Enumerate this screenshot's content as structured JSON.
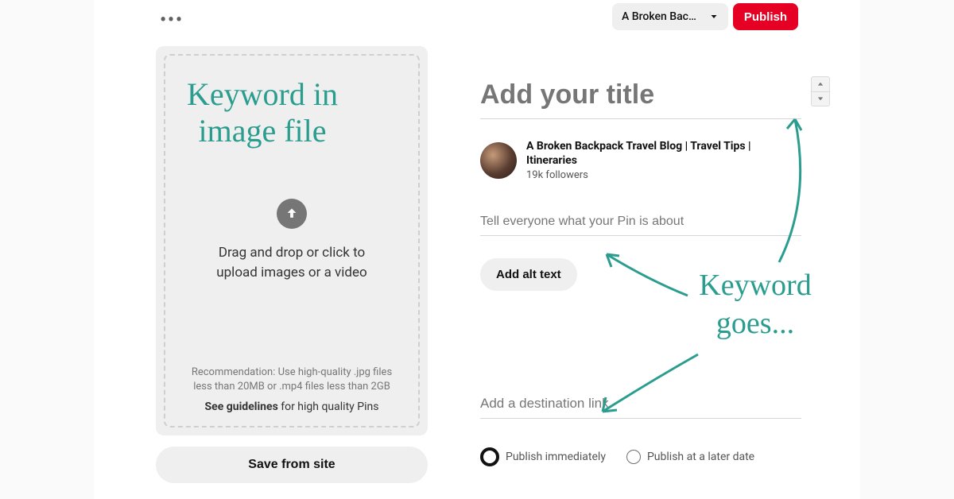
{
  "header": {
    "board_selected_label": "A Broken Bac…",
    "publish_label": "Publish"
  },
  "upload": {
    "instruction": "Drag and drop or click to upload images or a video",
    "recommendation": "Recommendation: Use high-quality .jpg files less than 20MB or .mp4 files less than 2GB",
    "guidelines_prefix": "See guidelines",
    "guidelines_suffix": " for high quality Pins",
    "save_site_label": "Save from site"
  },
  "form": {
    "title_placeholder": "Add your title",
    "profile_name": "A Broken Backpack Travel Blog | Travel Tips | Itineraries",
    "followers_text": "19k followers",
    "description_placeholder": "Tell everyone what your Pin is about",
    "alt_text_button": "Add alt text",
    "destination_placeholder": "Add a destination link"
  },
  "publish_options": {
    "immediate_label": "Publish immediately",
    "later_label": "Publish at a later date",
    "selected": "immediate"
  },
  "annotations": {
    "upload_note": "Keyword in image file",
    "right_note": "Keyword goes..."
  },
  "colors": {
    "accent": "#e60023",
    "annotation": "#2a9d8f"
  }
}
